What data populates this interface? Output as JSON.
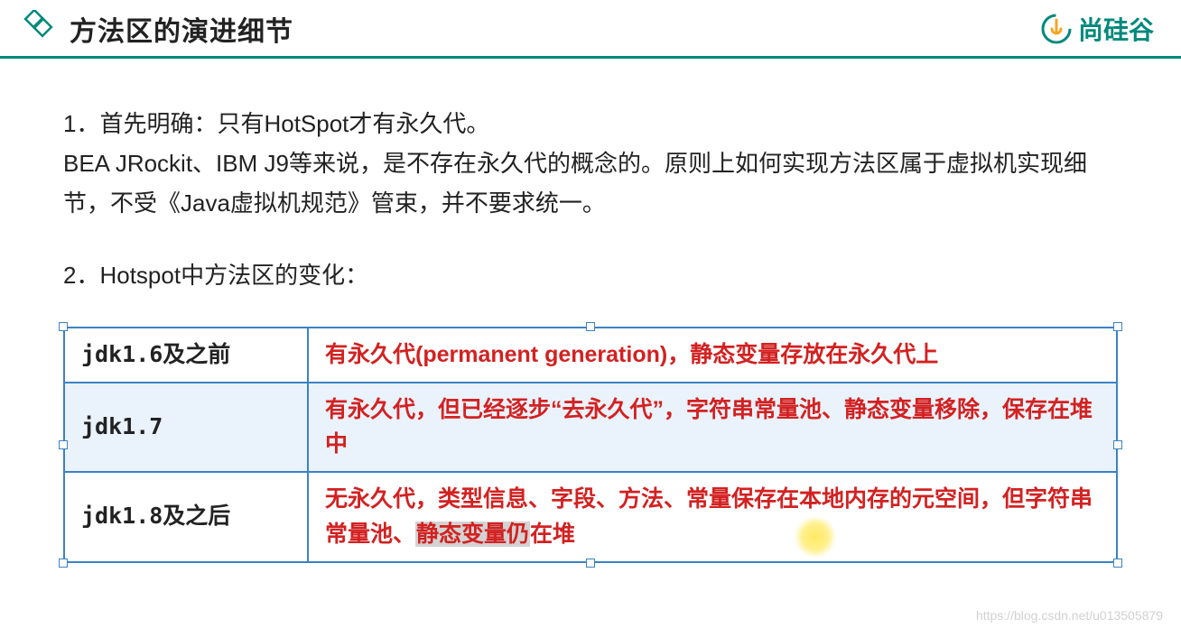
{
  "header": {
    "title": "方法区的演进细节",
    "logo_text": "尚硅谷"
  },
  "content": {
    "para1_line1": "1．首先明确：只有HotSpot才有永久代。",
    "para1_line2": "BEA JRockit、IBM J9等来说，是不存在永久代的概念的。原则上如何实现方法区属于虚拟机实现细节，不受《Java虚拟机规范》管束，并不要求统一。",
    "para2": "2．Hotspot中方法区的变化："
  },
  "table": {
    "rows": [
      {
        "col1": "jdk1.6及之前",
        "col2": "有永久代(permanent generation)，静态变量存放在永久代上"
      },
      {
        "col1": "jdk1.7",
        "col2": "有永久代，但已经逐步“去永久代”，字符串常量池、静态变量移除，保存在堆中"
      },
      {
        "col1": "jdk1.8及之后",
        "col2_prefix": "无永久代，类型信息、字段、方法、常量保存在本地内存的元空间，但字符串常量池、",
        "col2_sel": "静态变量仍",
        "col2_suffix": "在堆"
      }
    ]
  },
  "watermark": "https://blog.csdn.net/u013505879"
}
